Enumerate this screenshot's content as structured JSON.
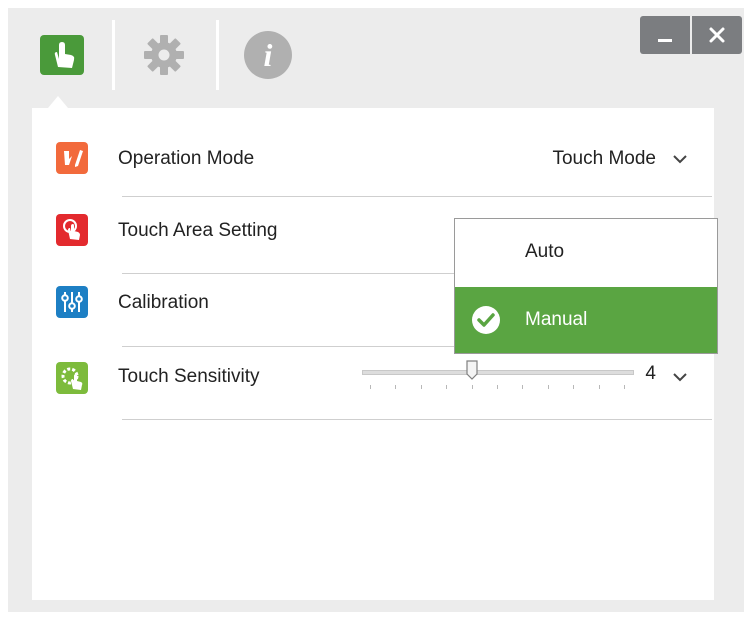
{
  "colors": {
    "accent_green": "#5aa542",
    "tab_active": "#4a9a3a",
    "icon_gray": "#b0b0b0",
    "operation_icon": "#f26a3c",
    "touch_area_icon": "#e32a2e",
    "calibration_icon": "#1d7fc4",
    "sensitivity_icon": "#7dbb3c"
  },
  "tabs": [
    {
      "icon": "touch-hand-icon",
      "active": true
    },
    {
      "icon": "gear-icon",
      "active": false
    },
    {
      "icon": "info-icon",
      "active": false
    }
  ],
  "window_controls": {
    "minimize": "_",
    "close": "✕"
  },
  "settings": {
    "operation_mode": {
      "label": "Operation Mode",
      "value": "Touch Mode",
      "icon": "hand-pen-icon"
    },
    "touch_area": {
      "label": "Touch Area Setting",
      "icon": "touch-area-icon"
    },
    "calibration": {
      "label": "Calibration",
      "icon": "sliders-icon"
    },
    "touch_sensitivity": {
      "label": "Touch Sensitivity",
      "value": "4",
      "level": 4,
      "min": 0,
      "max": 10,
      "icon": "gear-hand-icon"
    }
  },
  "dropdown": {
    "options": [
      {
        "label": "Auto",
        "selected": false
      },
      {
        "label": "Manual",
        "selected": true
      }
    ]
  }
}
